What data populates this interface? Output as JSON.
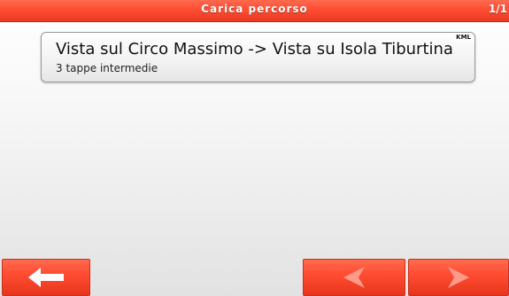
{
  "header": {
    "title": "Carica percorso",
    "page_indicator": "1/1"
  },
  "route_list": {
    "items": [
      {
        "title": "Vista sul Circo Massimo -> Vista su Isola Tiburtina",
        "subtitle": "3 tappe intermedie",
        "format_badge": "KML"
      }
    ]
  },
  "toolbar": {
    "back_icon": "arrow-left-icon",
    "prev_icon": "chevron-left-icon",
    "next_icon": "chevron-right-icon",
    "prev_enabled": false,
    "next_enabled": false
  },
  "colors": {
    "accent": "#ff4d33",
    "accent_dark": "#c8321c",
    "card_border": "#9a9a9a",
    "text": "#111111",
    "disabled_arrow": "#ff9a88"
  }
}
